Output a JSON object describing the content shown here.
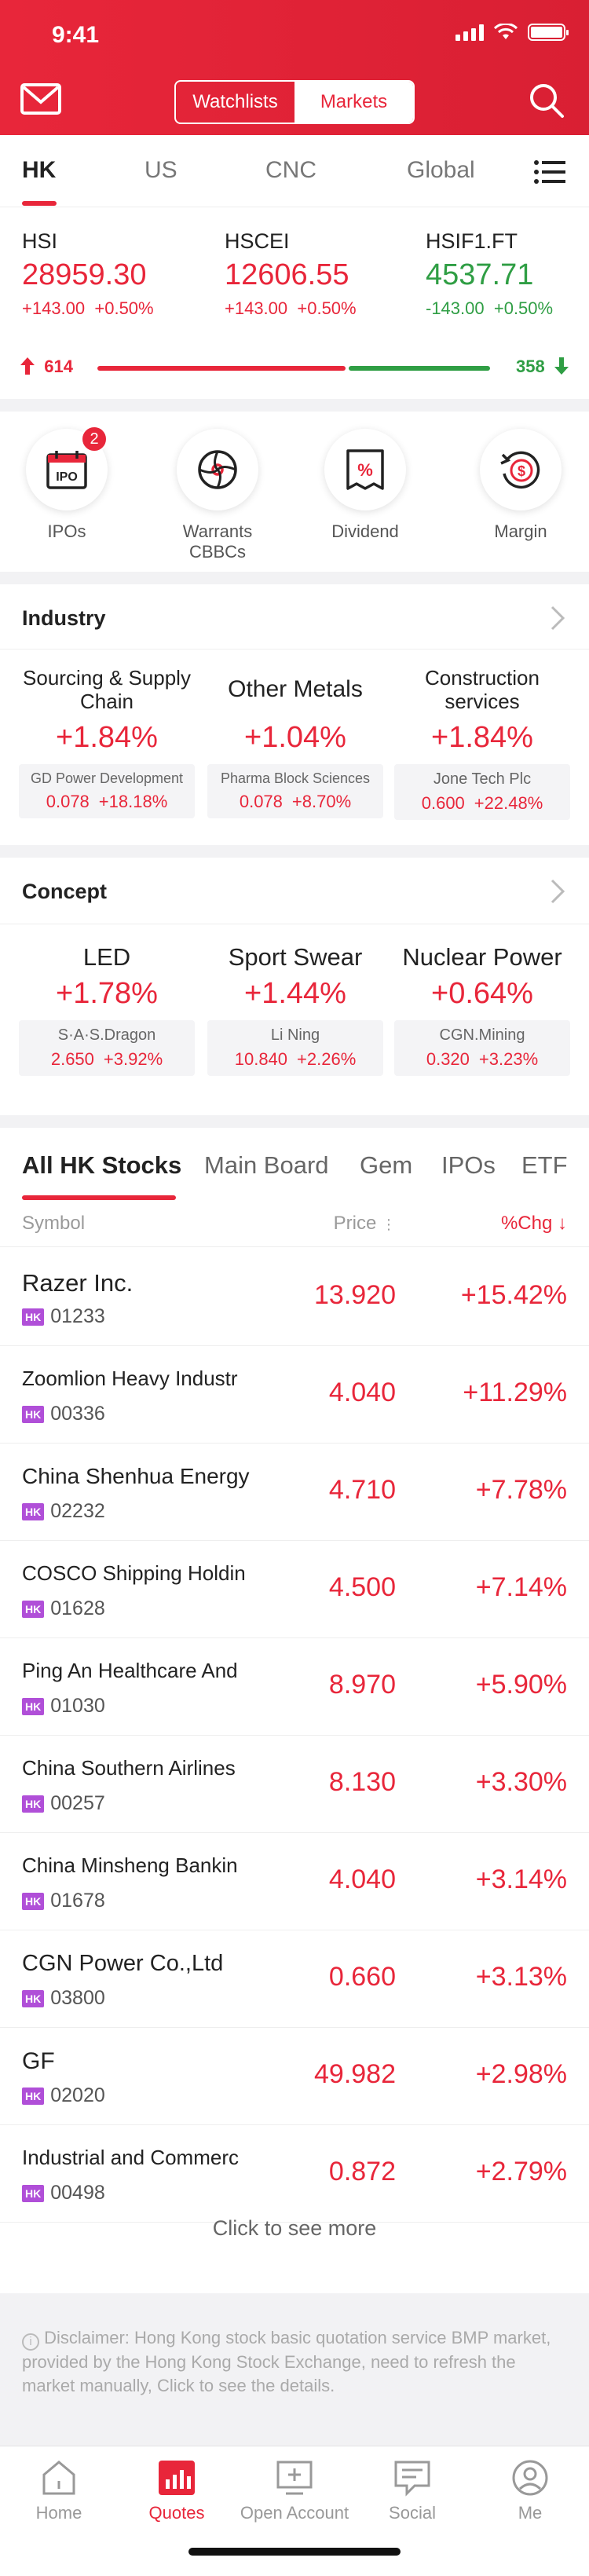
{
  "status": {
    "time": "9:41"
  },
  "header": {
    "segments": [
      "Watchlists",
      "Markets"
    ],
    "active_segment": "Markets"
  },
  "market_tabs": [
    "HK",
    "US",
    "CNC",
    "Global"
  ],
  "indices": [
    {
      "name": "HSI",
      "value": "28959.30",
      "change": "+143.00",
      "pct": "+0.50%",
      "dir": "up"
    },
    {
      "name": "HSCEI",
      "value": "12606.55",
      "change": "+143.00",
      "pct": "+0.50%",
      "dir": "up"
    },
    {
      "name": "HSIF1.FT",
      "value": "4537.71",
      "change": "-143.00",
      "pct": "+0.50%",
      "dir": "down"
    }
  ],
  "breadth": {
    "up": "614",
    "down": "358",
    "up_fraction": 0.632
  },
  "shortcuts": [
    {
      "label": "IPOs",
      "badge": "2",
      "icon": "ipo-calendar-icon"
    },
    {
      "label": "Warrants CBBCs",
      "icon": "warrants-icon"
    },
    {
      "label": "Dividend",
      "icon": "dividend-icon"
    },
    {
      "label": "Margin",
      "icon": "margin-icon"
    }
  ],
  "industry": {
    "title": "Industry",
    "cards": [
      {
        "name": "Sourcing & Supply Chain",
        "pct": "+1.84%",
        "stock": "GD Power Development",
        "price": "0.078",
        "chg": "+18.18%"
      },
      {
        "name": "Other Metals",
        "pct": "+1.04%",
        "stock": "Pharma Block Sciences",
        "price": "0.078",
        "chg": "+8.70%"
      },
      {
        "name": "Construction services",
        "pct": "+1.84%",
        "stock": "Jone Tech Plc",
        "price": "0.600",
        "chg": "+22.48%"
      }
    ]
  },
  "concept": {
    "title": "Concept",
    "cards": [
      {
        "name": "LED",
        "pct": "+1.78%",
        "stock": "S·A·S.Dragon",
        "price": "2.650",
        "chg": "+3.92%"
      },
      {
        "name": "Sport Swear",
        "pct": "+1.44%",
        "stock": "Li Ning",
        "price": "10.840",
        "chg": "+2.26%"
      },
      {
        "name": "Nuclear Power",
        "pct": "+0.64%",
        "stock": "CGN.Mining",
        "price": "0.320",
        "chg": "+3.23%"
      }
    ]
  },
  "stock_tabs": [
    "All HK Stocks",
    "Main Board",
    "Gem",
    "IPOs",
    "ETF"
  ],
  "columns": {
    "symbol": "Symbol",
    "price": "Price",
    "chg": "%Chg"
  },
  "market_tag": "HK",
  "stocks": [
    {
      "name": "Razer Inc.",
      "code": "01233",
      "price": "13.920",
      "pct": "+15.42%"
    },
    {
      "name": "Zoomlion Heavy Industr",
      "code": "00336",
      "price": "4.040",
      "pct": "+11.29%"
    },
    {
      "name": "China Shenhua Energy",
      "code": "02232",
      "price": "4.710",
      "pct": "+7.78%"
    },
    {
      "name": "COSCO Shipping Holdin",
      "code": "01628",
      "price": "4.500",
      "pct": "+7.14%"
    },
    {
      "name": "Ping An Healthcare And",
      "code": "01030",
      "price": "8.970",
      "pct": "+5.90%"
    },
    {
      "name": "China Southern Airlines",
      "code": "00257",
      "price": "8.130",
      "pct": "+3.30%"
    },
    {
      "name": "China Minsheng Bankin",
      "code": "01678",
      "price": "4.040",
      "pct": "+3.14%"
    },
    {
      "name": "CGN Power Co.,Ltd",
      "code": "03800",
      "price": "0.660",
      "pct": "+3.13%"
    },
    {
      "name": "GF",
      "code": "02020",
      "price": "49.982",
      "pct": "+2.98%"
    },
    {
      "name": "Industrial and Commerc",
      "code": "00498",
      "price": "0.872",
      "pct": "+2.79%"
    }
  ],
  "more_label": "Click to see more",
  "disclaimer": "Disclaimer: Hong Kong stock basic quotation service BMP market, provided by the Hong Kong Stock Exchange, need to refresh the market manually, Click to see the details.",
  "tabbar": [
    {
      "label": "Home",
      "icon": "home-icon"
    },
    {
      "label": "Quotes",
      "icon": "quotes-icon",
      "active": true
    },
    {
      "label": "Open Account",
      "icon": "open-account-icon"
    },
    {
      "label": "Social",
      "icon": "social-icon"
    },
    {
      "label": "Me",
      "icon": "me-icon"
    }
  ],
  "colors": {
    "accent": "#e8263a",
    "up": "#e8263a",
    "down": "#2f9e44",
    "tag": "#b04fd8"
  }
}
